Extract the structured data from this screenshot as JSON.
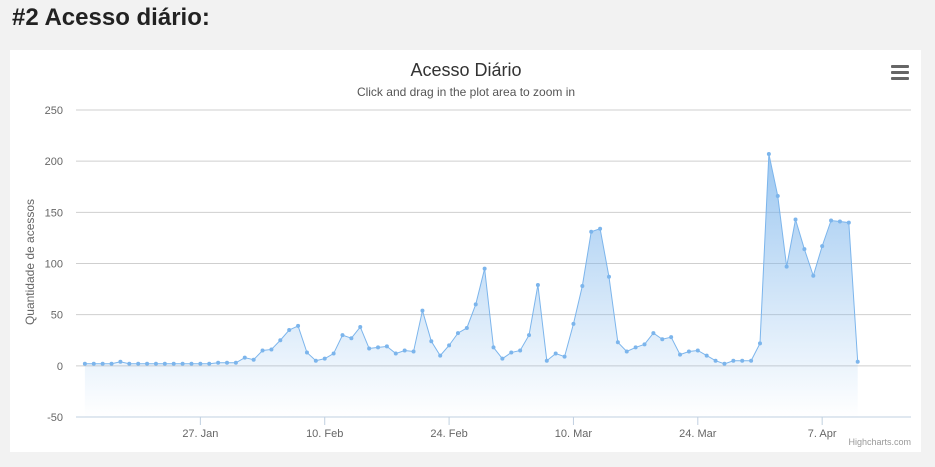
{
  "page": {
    "heading": "#2 Acesso diário:"
  },
  "chart_data": {
    "type": "area",
    "title": "Acesso Diário",
    "subtitle": "Click and drag in the plot area to zoom in",
    "ylabel": "Quantidade de acessos",
    "xlabel": "",
    "ylim": [
      -50,
      250
    ],
    "yticks": [
      -50,
      0,
      50,
      100,
      150,
      200,
      250
    ],
    "start_date": "2015-01-14",
    "xlim": [
      "2015-01-13",
      "2015-04-17"
    ],
    "xtick_labels": [
      {
        "date": "2015-01-27",
        "label": "27. Jan"
      },
      {
        "date": "2015-02-10",
        "label": "10. Feb"
      },
      {
        "date": "2015-02-24",
        "label": "24. Feb"
      },
      {
        "date": "2015-03-10",
        "label": "10. Mar"
      },
      {
        "date": "2015-03-24",
        "label": "24. Mar"
      },
      {
        "date": "2015-04-07",
        "label": "7. Apr"
      }
    ],
    "series": [
      {
        "name": "",
        "color": "#7cb5ec",
        "values": [
          2,
          2,
          2,
          2,
          4,
          2,
          2,
          2,
          2,
          2,
          2,
          2,
          2,
          2,
          2,
          3,
          3,
          3,
          8,
          6,
          15,
          16,
          25,
          35,
          39,
          13,
          5,
          7,
          12,
          30,
          27,
          38,
          17,
          18,
          19,
          12,
          15,
          14,
          54,
          24,
          10,
          20,
          32,
          37,
          60,
          95,
          18,
          7,
          13,
          15,
          30,
          79,
          5,
          12,
          9,
          41,
          78,
          131,
          134,
          87,
          23,
          14,
          18,
          21,
          32,
          26,
          28,
          11,
          14,
          15,
          10,
          5,
          2,
          5,
          5,
          5,
          22,
          207,
          166,
          97,
          143,
          114,
          88,
          117,
          142,
          141,
          140,
          4
        ]
      }
    ]
  },
  "credits": "Highcharts.com",
  "menu": {
    "icon": "hamburger-icon"
  }
}
